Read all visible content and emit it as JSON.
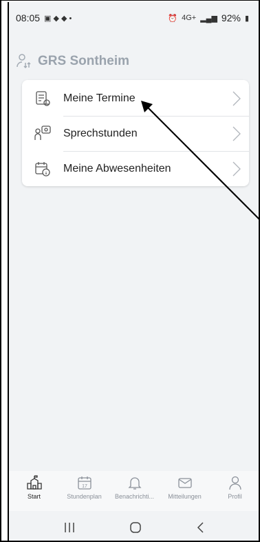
{
  "status_bar": {
    "time": "08:05",
    "battery": "92%",
    "signal_text": "4G+"
  },
  "header": {
    "title": "GRS Sontheim"
  },
  "menu": {
    "items": [
      {
        "label": "Meine Termine",
        "icon": "calendar-doc-icon"
      },
      {
        "label": "Sprechstunden",
        "icon": "consultation-icon"
      },
      {
        "label": "Meine Abwesenheiten",
        "icon": "calendar-info-icon"
      }
    ]
  },
  "bottom_nav": {
    "tabs": [
      {
        "label": "Start",
        "icon": "school-icon",
        "active": true
      },
      {
        "label": "Stundenplan",
        "icon": "calendar-17-icon",
        "date": "17"
      },
      {
        "label": "Benachrichti...",
        "icon": "bell-icon"
      },
      {
        "label": "Mitteilungen",
        "icon": "mail-icon"
      },
      {
        "label": "Profil",
        "icon": "person-icon"
      }
    ]
  },
  "system_nav": {
    "recents": "recents-icon",
    "home": "home-icon",
    "back": "back-icon"
  }
}
